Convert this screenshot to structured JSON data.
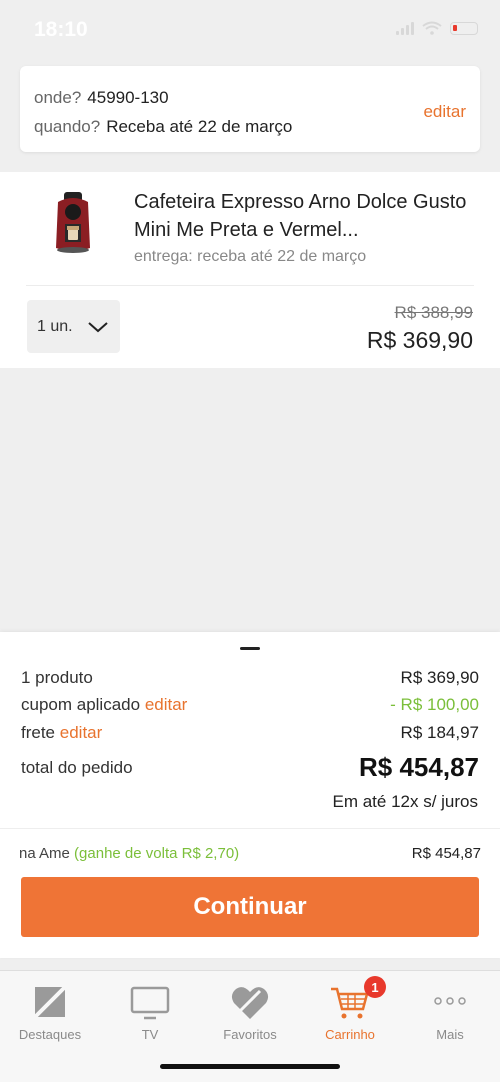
{
  "status": {
    "time": "18:10"
  },
  "delivery": {
    "where_label": "onde?",
    "where_value": "45990-130",
    "when_label": "quando?",
    "when_value": "Receba até 22 de março",
    "edit_label": "editar"
  },
  "product": {
    "name": "Cafeteira Expresso Arno Dolce Gusto Mini Me Preta e Vermel...",
    "delivery_text": "entrega: receba até 22 de março",
    "quantity": "1 un.",
    "old_price": "R$ 388,99",
    "price": "R$ 369,90"
  },
  "summary": {
    "products_label": "1 produto",
    "products_value": "R$ 369,90",
    "coupon_label": "cupom aplicado",
    "coupon_edit": "editar",
    "coupon_value": "- R$ 100,00",
    "shipping_label": "frete",
    "shipping_edit": "editar",
    "shipping_value": "R$ 184,97",
    "total_label": "total do pedido",
    "total_value": "R$ 454,87",
    "installments": "Em até 12x s/ juros",
    "ame_label": "na Ame",
    "ame_cashback": "(ganhe de volta R$ 2,70)",
    "ame_value": "R$ 454,87",
    "continue_label": "Continuar"
  },
  "nav": {
    "items": [
      {
        "label": "Destaques",
        "icon": "highlights-icon"
      },
      {
        "label": "TV",
        "icon": "tv-icon"
      },
      {
        "label": "Favoritos",
        "icon": "heart-icon"
      },
      {
        "label": "Carrinho",
        "icon": "cart-icon",
        "badge": "1",
        "active": true
      },
      {
        "label": "Mais",
        "icon": "more-dots-icon"
      }
    ]
  },
  "colors": {
    "accent": "#ef7436",
    "link": "#e8732e",
    "success": "#7bbf3a",
    "badge": "#e8392c"
  }
}
